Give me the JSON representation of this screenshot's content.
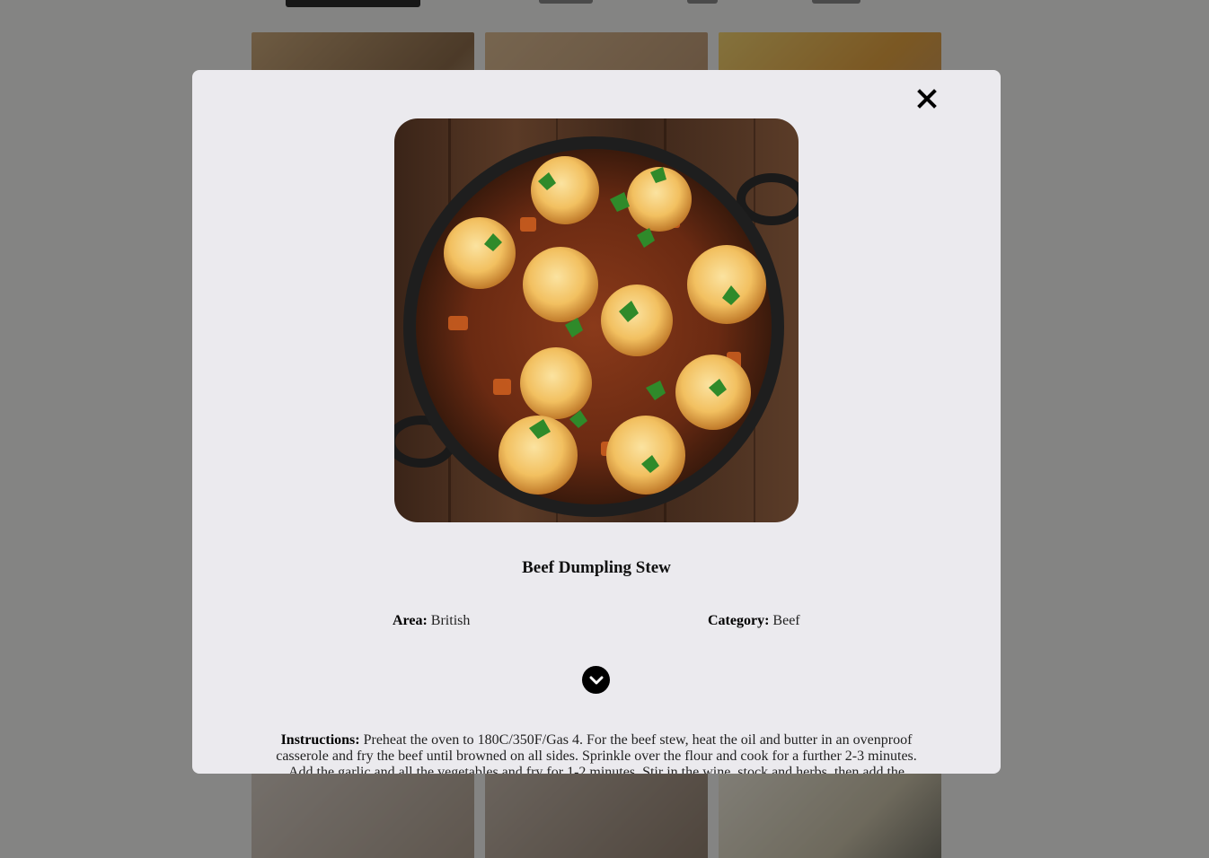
{
  "modal": {
    "title": "Beef Dumpling Stew",
    "area_label": "Area:",
    "area_value": "British",
    "category_label": "Category:",
    "category_value": "Beef",
    "instructions_label": "Instructions:",
    "instructions_text": "Preheat the oven to 180C/350F/Gas 4. For the beef stew, heat the oil and butter in an ovenproof casserole and fry the beef until browned on all sides. Sprinkle over the flour and cook for a further 2-3 minutes. Add the garlic and all the vegetables and fry for 1-2 minutes. Stir in the wine, stock and herbs, then add the"
  },
  "icons": {
    "close": "close-icon",
    "expand": "chevron-down-icon"
  },
  "colors": {
    "modal_bg": "#ebeaee",
    "backdrop": "#888884",
    "button": "#000000"
  }
}
